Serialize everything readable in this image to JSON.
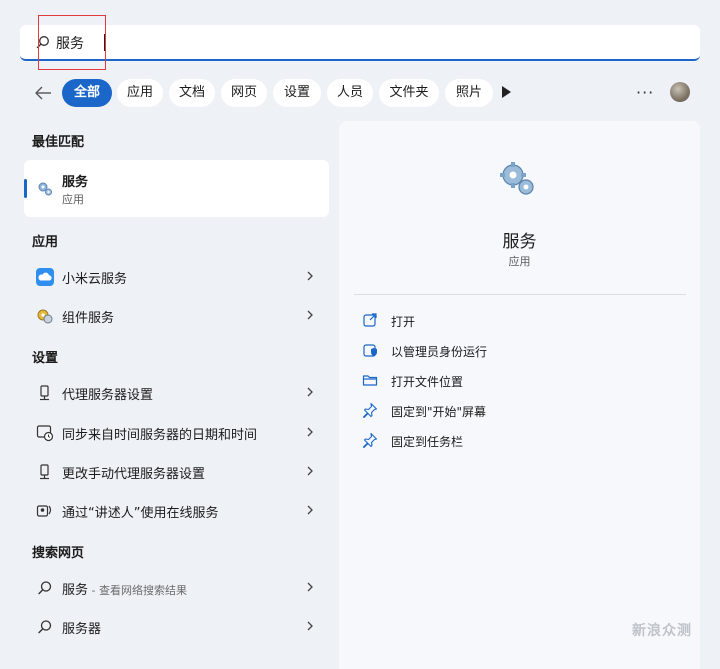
{
  "search": {
    "query": "服务"
  },
  "filters": {
    "items": [
      "全部",
      "应用",
      "文档",
      "网页",
      "设置",
      "人员",
      "文件夹",
      "照片"
    ],
    "active_index": 0,
    "more_label": "···"
  },
  "best_match": {
    "heading": "最佳匹配",
    "title": "服务",
    "subtitle": "应用"
  },
  "apps": {
    "heading": "应用",
    "items": [
      {
        "label": "小米云服务",
        "icon": "xiaomi-cloud-icon"
      },
      {
        "label": "组件服务",
        "icon": "component-services-icon"
      }
    ]
  },
  "settings": {
    "heading": "设置",
    "items": [
      {
        "label": "代理服务器设置",
        "icon": "proxy-icon"
      },
      {
        "label": "同步来自时间服务器的日期和时间",
        "icon": "clock-sync-icon"
      },
      {
        "label": "更改手动代理服务器设置",
        "icon": "proxy-icon"
      },
      {
        "label": "通过“讲述人”使用在线服务",
        "icon": "narrator-icon"
      }
    ]
  },
  "web": {
    "heading": "搜索网页",
    "items": [
      {
        "label": "服务",
        "suffix": " - 查看网络搜索结果"
      },
      {
        "label": "服务器",
        "suffix": ""
      }
    ]
  },
  "detail": {
    "title": "服务",
    "subtitle": "应用",
    "actions": [
      {
        "label": "打开",
        "icon": "open-external-icon"
      },
      {
        "label": "以管理员身份运行",
        "icon": "admin-shield-icon"
      },
      {
        "label": "打开文件位置",
        "icon": "folder-icon"
      },
      {
        "label": "固定到\"开始\"屏幕",
        "icon": "pin-icon"
      },
      {
        "label": "固定到任务栏",
        "icon": "pin-icon"
      }
    ]
  },
  "watermark": "新浪众测",
  "colors": {
    "accent": "#1a66c9",
    "annotation": "#e23b3b"
  }
}
